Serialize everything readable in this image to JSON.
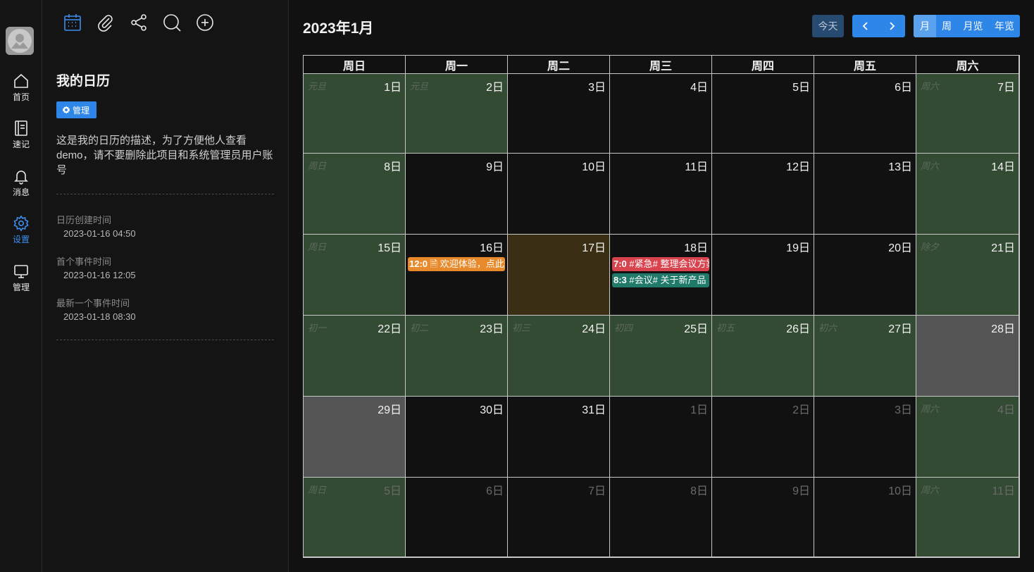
{
  "nav": {
    "items": [
      {
        "label": "首页",
        "icon": "home-icon"
      },
      {
        "label": "速记",
        "icon": "notebook-icon"
      },
      {
        "label": "消息",
        "icon": "bell-icon"
      },
      {
        "label": "设置",
        "icon": "gear-icon"
      },
      {
        "label": "管理",
        "icon": "monitor-icon"
      }
    ],
    "active_item": "设置"
  },
  "panel": {
    "tools": [
      "calendar-icon",
      "paperclip-icon",
      "share-icon",
      "search-icon",
      "plus-circle-icon"
    ],
    "title": "我的日历",
    "manage_label": "管理",
    "description": "这是我的日历的描述，为了方便他人查看demo，请不要删除此项目和系统管理员用户账号",
    "meta": [
      {
        "label": "日历创建时间",
        "value": "2023-01-16 04:50"
      },
      {
        "label": "首个事件时间",
        "value": "2023-01-16 12:05"
      },
      {
        "label": "最新一个事件时间",
        "value": "2023-01-18 08:30"
      }
    ]
  },
  "header": {
    "month_title": "2023年1月",
    "today_label": "今天",
    "prev_glyph": "‹",
    "next_glyph": "›",
    "views": [
      "月",
      "周",
      "月览",
      "年览"
    ],
    "active_view": "月"
  },
  "colors": {
    "accent": "#2d86e8",
    "weekend": "#334a33",
    "today": "#3a2e14",
    "gray": "#555555"
  },
  "calendar": {
    "weekdays": [
      "周日",
      "周一",
      "周二",
      "周三",
      "周四",
      "周五",
      "周六"
    ],
    "weeks": [
      [
        {
          "day": "1日",
          "lunar": "元旦",
          "type": "weekend"
        },
        {
          "day": "2日",
          "lunar": "元旦",
          "type": "weekend"
        },
        {
          "day": "3日",
          "lunar": "",
          "type": "normal"
        },
        {
          "day": "4日",
          "lunar": "",
          "type": "normal"
        },
        {
          "day": "5日",
          "lunar": "",
          "type": "normal"
        },
        {
          "day": "6日",
          "lunar": "",
          "type": "normal"
        },
        {
          "day": "7日",
          "lunar": "周六",
          "type": "weekend"
        }
      ],
      [
        {
          "day": "8日",
          "lunar": "周日",
          "type": "weekend"
        },
        {
          "day": "9日",
          "lunar": "",
          "type": "normal"
        },
        {
          "day": "10日",
          "lunar": "",
          "type": "normal"
        },
        {
          "day": "11日",
          "lunar": "",
          "type": "normal"
        },
        {
          "day": "12日",
          "lunar": "",
          "type": "normal"
        },
        {
          "day": "13日",
          "lunar": "",
          "type": "normal"
        },
        {
          "day": "14日",
          "lunar": "周六",
          "type": "weekend"
        }
      ],
      [
        {
          "day": "15日",
          "lunar": "周日",
          "type": "weekend"
        },
        {
          "day": "16日",
          "lunar": "",
          "type": "normal",
          "events": [
            {
              "time": "12:0",
              "text": "🗎 欢迎体验，点此查看",
              "color": "orange"
            }
          ]
        },
        {
          "day": "17日",
          "lunar": "",
          "type": "today"
        },
        {
          "day": "18日",
          "lunar": "",
          "type": "normal",
          "events": [
            {
              "time": "7:0",
              "text": "#紧急# 整理会议方案",
              "color": "red"
            },
            {
              "time": "8:3",
              "text": "#会议# 关于新产品",
              "color": "teal"
            }
          ]
        },
        {
          "day": "19日",
          "lunar": "",
          "type": "normal"
        },
        {
          "day": "20日",
          "lunar": "",
          "type": "normal"
        },
        {
          "day": "21日",
          "lunar": "除夕",
          "type": "weekend"
        }
      ],
      [
        {
          "day": "22日",
          "lunar": "初一",
          "type": "weekend"
        },
        {
          "day": "23日",
          "lunar": "初二",
          "type": "weekend"
        },
        {
          "day": "24日",
          "lunar": "初三",
          "type": "weekend"
        },
        {
          "day": "25日",
          "lunar": "初四",
          "type": "weekend"
        },
        {
          "day": "26日",
          "lunar": "初五",
          "type": "weekend"
        },
        {
          "day": "27日",
          "lunar": "初六",
          "type": "weekend"
        },
        {
          "day": "28日",
          "lunar": "",
          "type": "gray"
        }
      ],
      [
        {
          "day": "29日",
          "lunar": "",
          "type": "gray"
        },
        {
          "day": "30日",
          "lunar": "",
          "type": "normal"
        },
        {
          "day": "31日",
          "lunar": "",
          "type": "normal"
        },
        {
          "day": "1日",
          "lunar": "",
          "type": "other"
        },
        {
          "day": "2日",
          "lunar": "",
          "type": "other"
        },
        {
          "day": "3日",
          "lunar": "",
          "type": "other"
        },
        {
          "day": "4日",
          "lunar": "周六",
          "type": "weekend-other"
        }
      ],
      [
        {
          "day": "5日",
          "lunar": "周日",
          "type": "weekend-other"
        },
        {
          "day": "6日",
          "lunar": "",
          "type": "other"
        },
        {
          "day": "7日",
          "lunar": "",
          "type": "other"
        },
        {
          "day": "8日",
          "lunar": "",
          "type": "other"
        },
        {
          "day": "9日",
          "lunar": "",
          "type": "other"
        },
        {
          "day": "10日",
          "lunar": "",
          "type": "other"
        },
        {
          "day": "11日",
          "lunar": "周六",
          "type": "weekend-other"
        }
      ]
    ]
  }
}
